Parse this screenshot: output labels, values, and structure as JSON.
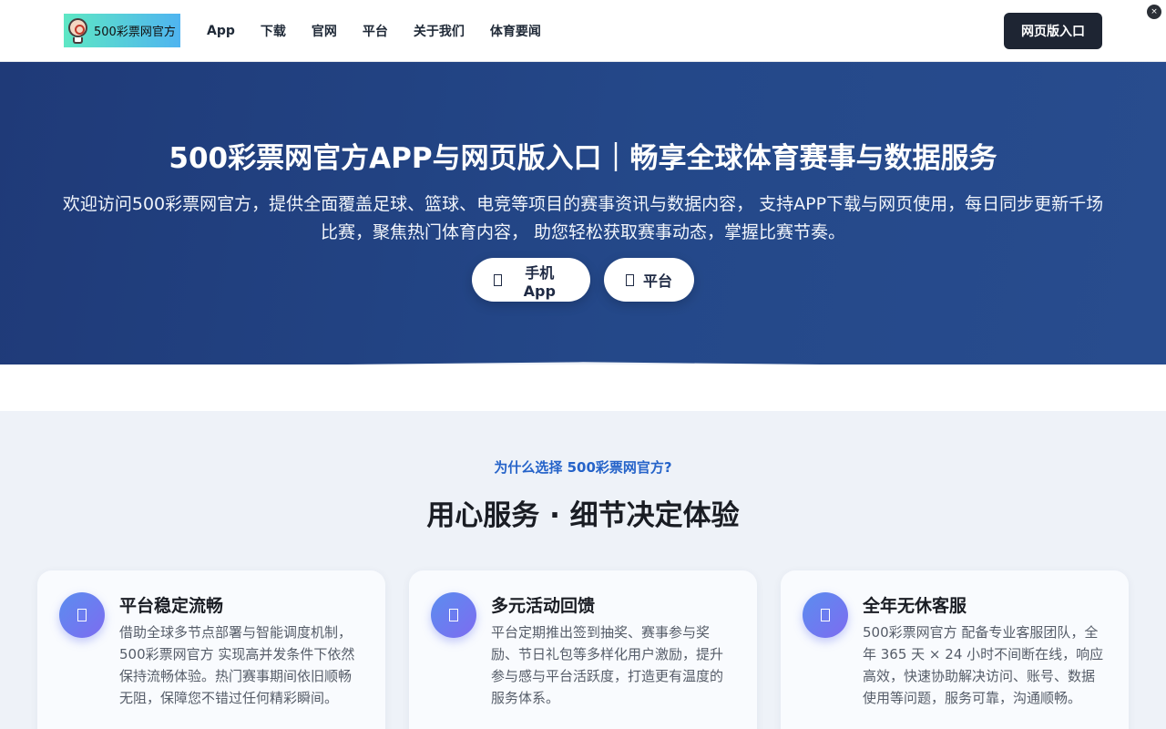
{
  "header": {
    "logo_text": "500彩票网官方",
    "nav": [
      "App",
      "下载",
      "官网",
      "平台",
      "关于我们",
      "体育要闻"
    ],
    "web_entry_label": "网页版入口",
    "close_label": "×"
  },
  "hero": {
    "title": "500彩票网官方APP与网页版入口｜畅享全球体育赛事与数据服务",
    "description": "欢迎访问500彩票网官方，提供全面覆盖足球、篮球、电竞等项目的赛事资讯与数据内容， 支持APP下载与网页使用，每日同步更新千场比赛，聚焦热门体育内容， 助您轻松获取赛事动态，掌握比赛节奏。",
    "app_button": "手机App",
    "platform_button": "平台"
  },
  "features": {
    "eyebrow": "为什么选择 500彩票网官方?",
    "title": "用心服务 · 细节决定体验",
    "cards": [
      {
        "title": "平台稳定流畅",
        "text": "借助全球多节点部署与智能调度机制，500彩票网官方 实现高并发条件下依然保持流畅体验。热门赛事期间依旧顺畅无阻，保障您不错过任何精彩瞬间。"
      },
      {
        "title": "多元活动回馈",
        "text": "平台定期推出签到抽奖、赛事参与奖励、节日礼包等多样化用户激励，提升参与感与平台活跃度，打造更有温度的服务体系。"
      },
      {
        "title": "全年无休客服",
        "text": "500彩票网官方 配备专业客服团队，全年 365 天 × 24 小时不间断在线，响应高效，快速协助解决访问、账号、数据使用等问题，服务可靠，沟通顺畅。"
      }
    ]
  },
  "colors": {
    "hero_bg": "#244889",
    "dark_button": "#1e2533",
    "eyebrow": "#2563c9",
    "icon_gradient_start": "#5b8def",
    "icon_gradient_end": "#7d6cf0"
  }
}
